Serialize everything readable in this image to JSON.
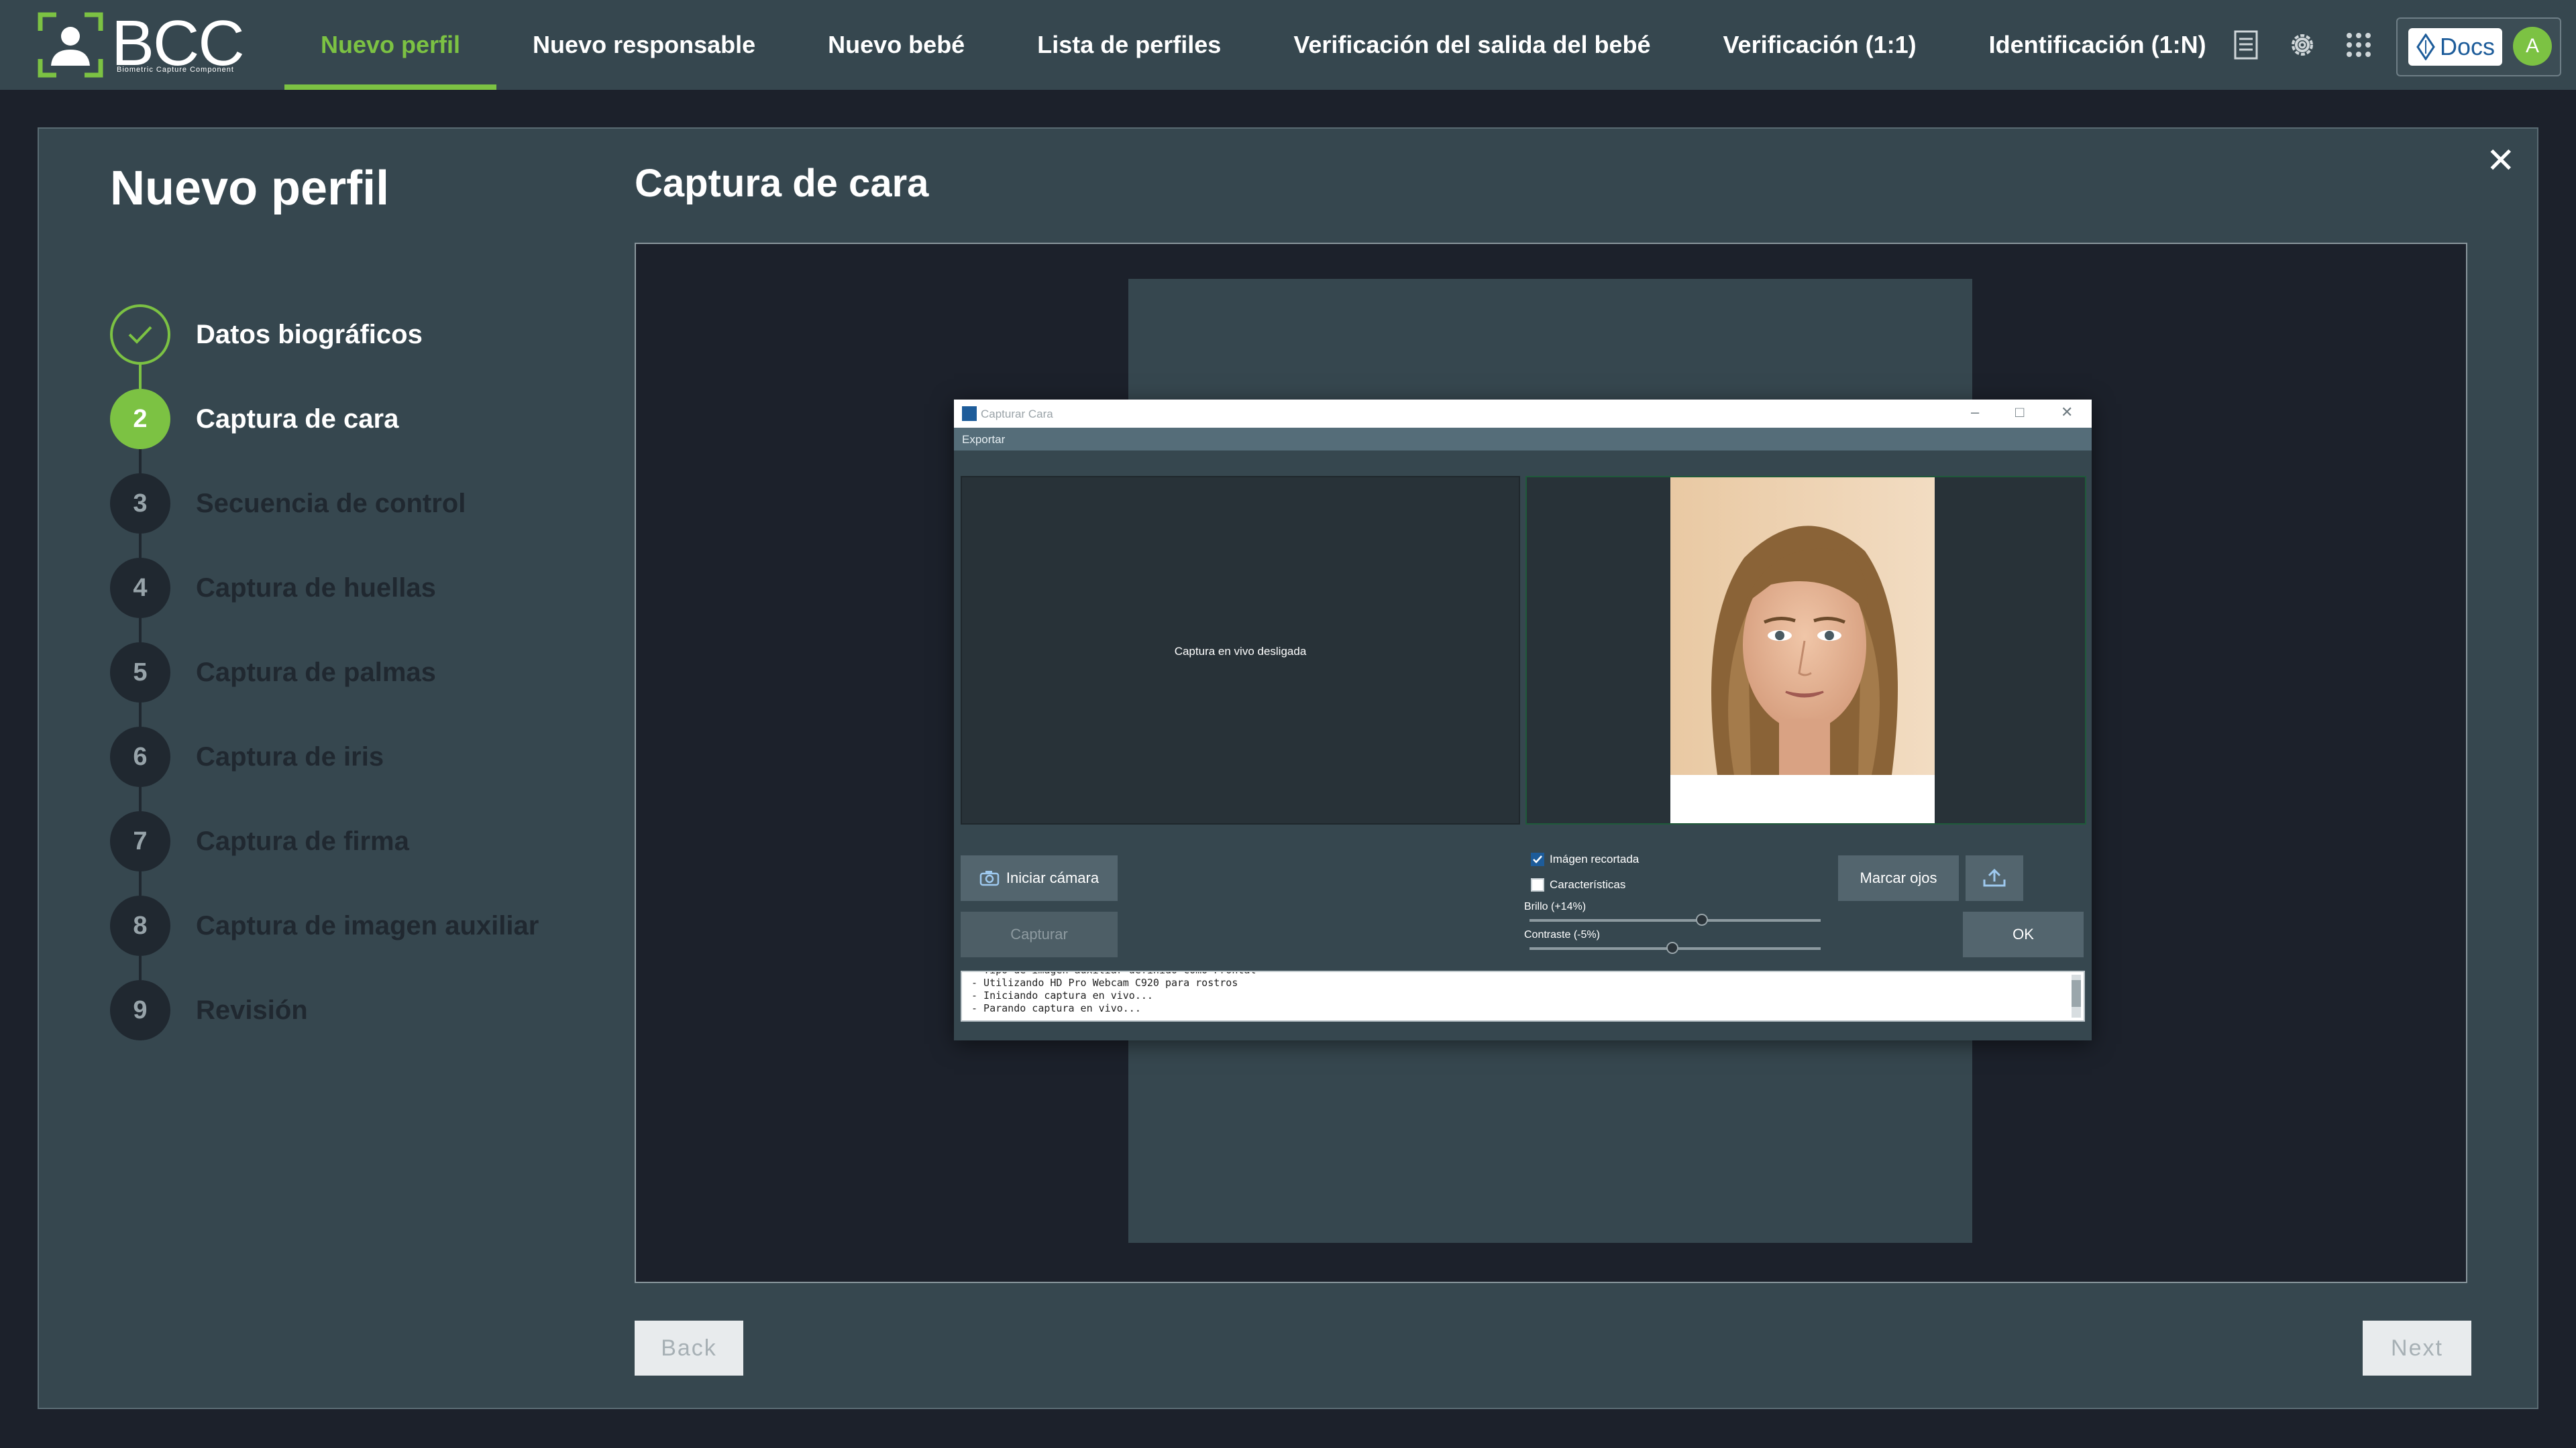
{
  "app": {
    "logo_text": "BCC",
    "logo_subtitle": "Biometric Capture Component",
    "nav": [
      {
        "label": "Nuevo perfil",
        "active": true
      },
      {
        "label": "Nuevo responsable"
      },
      {
        "label": "Nuevo bebé"
      },
      {
        "label": "Lista de perfiles"
      },
      {
        "label": "Verificación del salida del bebé"
      },
      {
        "label": "Verificación (1:1)"
      },
      {
        "label": "Identificación (1:N)"
      }
    ],
    "toolbar_icons": [
      "document-list-icon",
      "gear-icon",
      "app-grid-icon"
    ],
    "docs_label": "Docs",
    "avatar_initial": "A",
    "accent_color": "#7cc243"
  },
  "page": {
    "title": "Nuevo perfil",
    "section_title": "Captura de cara",
    "back_label": "Back",
    "next_label": "Next"
  },
  "steps": [
    {
      "number": "1",
      "label": "Datos biográficos",
      "state": "done"
    },
    {
      "number": "2",
      "label": "Captura de cara",
      "state": "current"
    },
    {
      "number": "3",
      "label": "Secuencia de control",
      "state": "pending"
    },
    {
      "number": "4",
      "label": "Captura de huellas",
      "state": "pending"
    },
    {
      "number": "5",
      "label": "Captura de palmas",
      "state": "pending"
    },
    {
      "number": "6",
      "label": "Captura de iris",
      "state": "pending"
    },
    {
      "number": "7",
      "label": "Captura de firma",
      "state": "pending"
    },
    {
      "number": "8",
      "label": "Captura de imagen auxiliar",
      "state": "pending"
    },
    {
      "number": "9",
      "label": "Revisión",
      "state": "pending"
    }
  ],
  "dialog": {
    "title": "Capturar Cara",
    "menu": "Exportar",
    "live_status": "Captura en vivo desligada",
    "start_camera_label": "Iniciar cámara",
    "capture_label": "Capturar",
    "cropped_label": "Imágen recortada",
    "cropped_checked": true,
    "features_label": "Características",
    "features_checked": false,
    "brightness_label": "Brillo (+14%)",
    "brightness_value": 14,
    "contrast_label": "Contraste (-5%)",
    "contrast_value": -5,
    "mark_eyes_label": "Marcar ojos",
    "ok_label": "OK",
    "log": [
      "- Tipo de imagen auxiliar definido como Frontal",
      "- Utilizando HD Pro Webcam C920 para rostros",
      "- Iniciando captura en vivo...",
      "- Parando captura en vivo..."
    ]
  }
}
